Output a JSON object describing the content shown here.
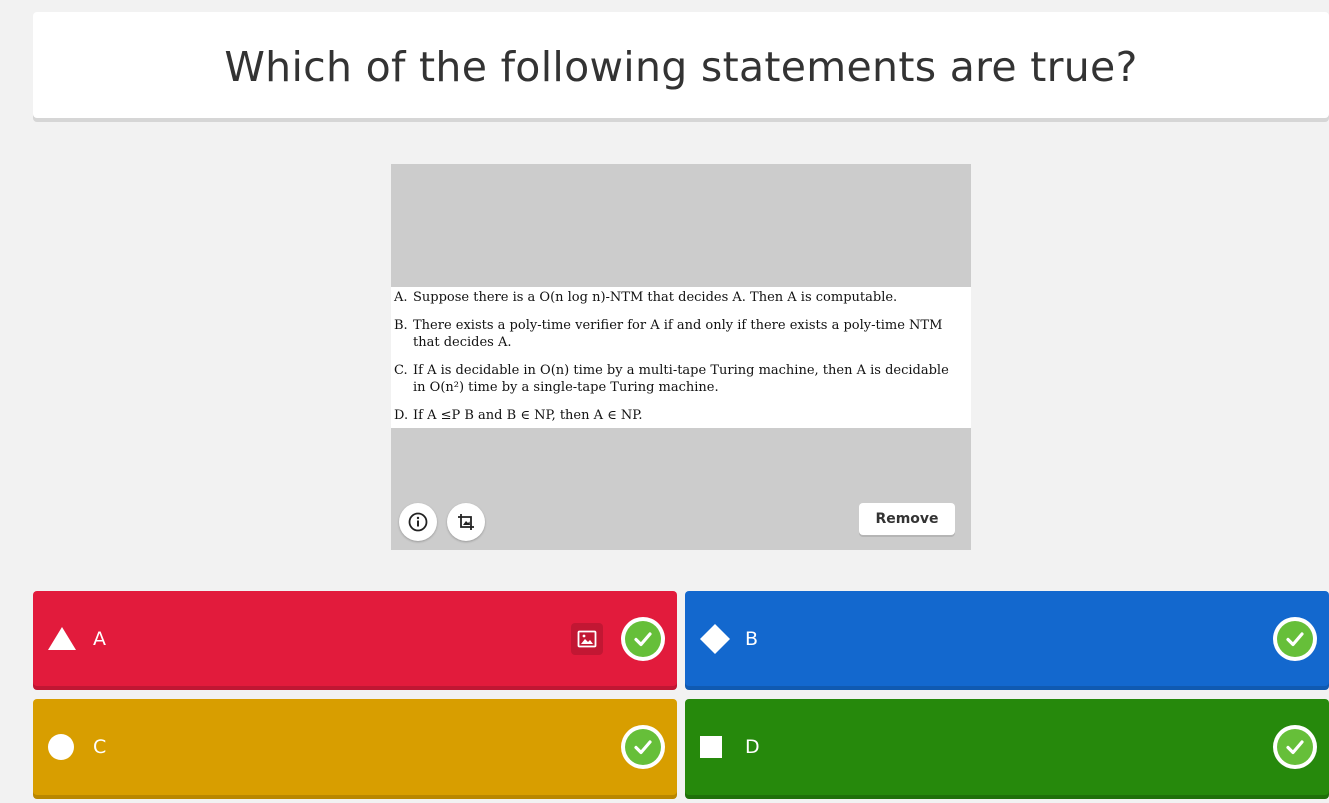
{
  "question": {
    "title": "Which of the following statements are true?"
  },
  "media": {
    "statements": [
      {
        "letter": "A.",
        "text": "Suppose there is a O(n log n)-NTM that decides A. Then A is computable."
      },
      {
        "letter": "B.",
        "text": "There exists a poly-time verifier for A if and only if there exists a poly-time NTM that decides A."
      },
      {
        "letter": "C.",
        "text": "If A is decidable in O(n) time by a multi-tape Turing machine, then A is decidable in O(n²) time by a single-tape Turing machine."
      },
      {
        "letter": "D.",
        "text": "If A ≤P B and B ∈ NP, then A ∈ NP."
      }
    ],
    "info_icon": "info-icon",
    "crop_icon": "crop-icon",
    "remove_label": "Remove"
  },
  "answers": [
    {
      "label": "A",
      "shape": "triangle",
      "color": "#e21b3c",
      "correct": true,
      "has_image_button": true
    },
    {
      "label": "B",
      "shape": "diamond",
      "color": "#1368ce",
      "correct": true,
      "has_image_button": false
    },
    {
      "label": "C",
      "shape": "circle",
      "color": "#d89e00",
      "correct": true,
      "has_image_button": false
    },
    {
      "label": "D",
      "shape": "square",
      "color": "#26890c",
      "correct": true,
      "has_image_button": false
    }
  ],
  "colors": {
    "correct_green": "#66bf39",
    "background": "#f2f2f2"
  }
}
